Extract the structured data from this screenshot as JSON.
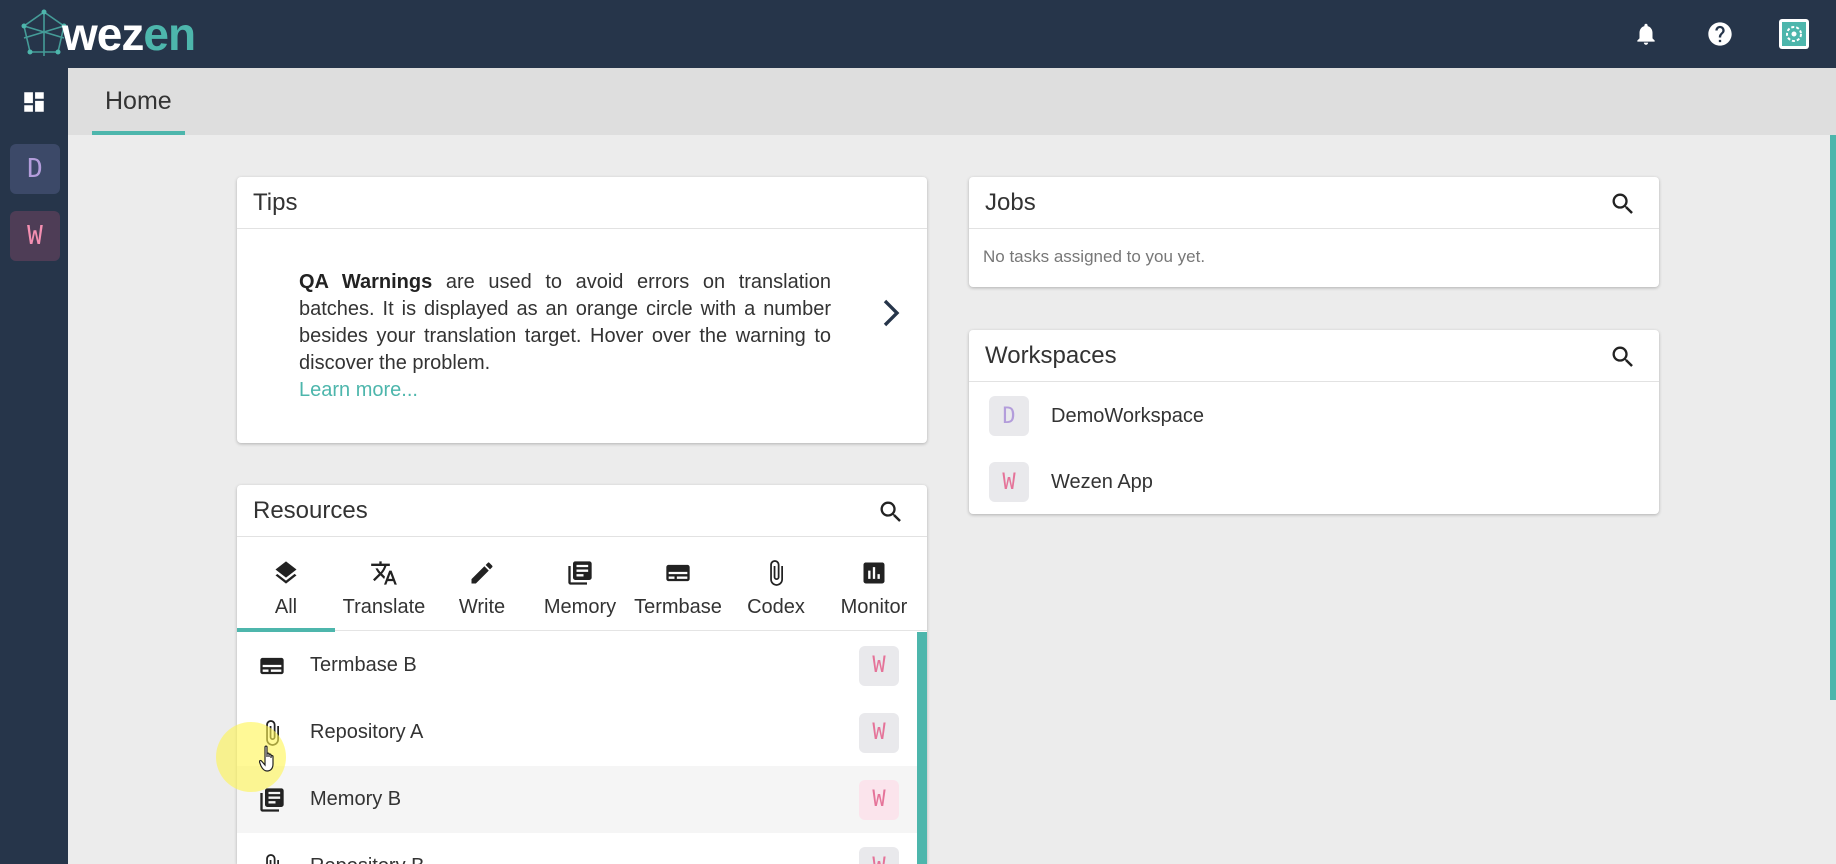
{
  "app": {
    "logo_text_main": "wez",
    "logo_text_accent": "en",
    "colors": {
      "topbar": "#26354a",
      "accent": "#4db6ac",
      "workspace_d": "#b39ddb",
      "workspace_w": "#e57399"
    }
  },
  "topbar": {
    "icons": [
      "bell-icon",
      "help-icon",
      "profile-avatar-icon"
    ]
  },
  "rail": {
    "home_icon": "dashboard-icon",
    "workspaces": [
      {
        "letter": "D"
      },
      {
        "letter": "W"
      }
    ]
  },
  "tabs": {
    "home": "Home"
  },
  "tips": {
    "title": "Tips",
    "bold": "QA Warnings",
    "text": " are used to avoid errors on translation batches. It is displayed as an orange circle with a number besides your translation target. Hover over the warning to discover the problem.",
    "link": "Learn more..."
  },
  "resources": {
    "title": "Resources",
    "tabs": [
      {
        "label": "All",
        "icon": "layers-icon"
      },
      {
        "label": "Translate",
        "icon": "translate-icon"
      },
      {
        "label": "Write",
        "icon": "pencil-icon"
      },
      {
        "label": "Memory",
        "icon": "library-icon"
      },
      {
        "label": "Termbase",
        "icon": "keyboard-icon"
      },
      {
        "label": "Codex",
        "icon": "paperclip-icon"
      },
      {
        "label": "Monitor",
        "icon": "chart-icon"
      }
    ],
    "active_tab": "All",
    "items": [
      {
        "name": "Termbase B",
        "icon": "keyboard-icon",
        "workspace": "W"
      },
      {
        "name": "Repository A",
        "icon": "paperclip-icon",
        "workspace": "W"
      },
      {
        "name": "Memory B",
        "icon": "library-icon",
        "workspace": "W"
      },
      {
        "name": "Repository B",
        "icon": "paperclip-icon",
        "workspace": "W"
      }
    ]
  },
  "jobs": {
    "title": "Jobs",
    "empty": "No tasks assigned to you yet."
  },
  "workspaces": {
    "title": "Workspaces",
    "items": [
      {
        "letter": "D",
        "name": "DemoWorkspace"
      },
      {
        "letter": "W",
        "name": "Wezen App"
      }
    ]
  }
}
